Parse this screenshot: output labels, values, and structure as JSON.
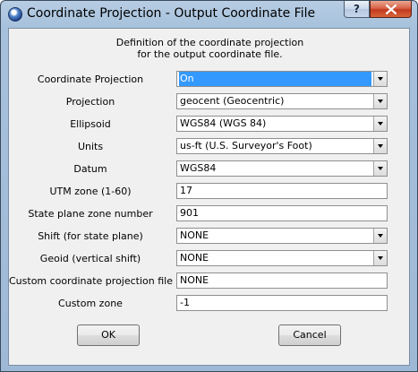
{
  "window": {
    "title": "Coordinate Projection - Output Coordinate File",
    "help_glyph": "?",
    "close_glyph": "✕"
  },
  "heading": {
    "line1": "Definition of the coordinate projection",
    "line2": "for the output coordinate file."
  },
  "fields": [
    {
      "label": "Coordinate Projection",
      "value": "On",
      "type": "select"
    },
    {
      "label": "Projection",
      "value": "geocent (Geocentric)",
      "type": "select"
    },
    {
      "label": "Ellipsoid",
      "value": "WGS84 (WGS 84)",
      "type": "select"
    },
    {
      "label": "Units",
      "value": "us-ft (U.S. Surveyor's Foot)",
      "type": "select"
    },
    {
      "label": "Datum",
      "value": "WGS84",
      "type": "select"
    },
    {
      "label": "UTM zone (1-60)",
      "value": "17",
      "type": "text"
    },
    {
      "label": "State plane zone number",
      "value": "901",
      "type": "text"
    },
    {
      "label": "Shift (for state plane)",
      "value": "NONE",
      "type": "select"
    },
    {
      "label": "Geoid (vertical shift)",
      "value": "NONE",
      "type": "select"
    },
    {
      "label": "Custom coordinate projection file",
      "value": "NONE",
      "type": "text"
    },
    {
      "label": "Custom zone",
      "value": "-1",
      "type": "text"
    }
  ],
  "buttons": {
    "ok": "OK",
    "cancel": "Cancel"
  }
}
